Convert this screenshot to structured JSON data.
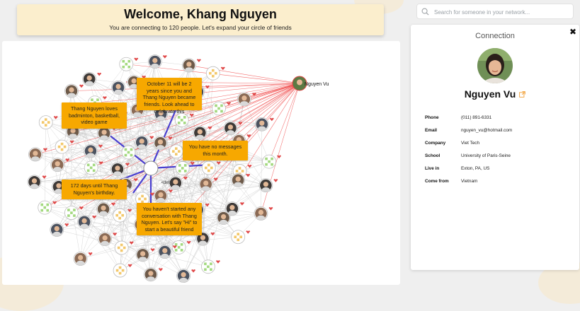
{
  "welcome": {
    "title": "Welcome, Khang Nguyen",
    "subtitle": "You are connecting to 120 people. Let's expand your circle of friends"
  },
  "search": {
    "placeholder": "Search for someone in your network..."
  },
  "graph": {
    "highlight_label": "Nguyen Vu",
    "center_label": "<del>",
    "tooltips": [
      "October 11 will be 2 years since you and Thang Nguyen became friends. Look ahead to celebrate this",
      "Thang Nguyen loves badminton, basketball, video game",
      "You have no messages this month.",
      "172 days until Thang Nguyen's birthday.",
      "You haven't started any conversation with Thang Nguyen. Let's say \"Hi\" to start a beautiful friend"
    ],
    "colors": {
      "edge": "#c9c9c9",
      "highlight_edge": "#ef3b3b",
      "focus_edge": "#4a3fd0",
      "tooltip": "#f7a800"
    }
  },
  "connection": {
    "title": "Connection",
    "close_icon": "close-icon",
    "name": "Nguyen Vu",
    "link_icon": "external-link-icon",
    "details": [
      {
        "label": "Phone",
        "value": "(011) 891-6331"
      },
      {
        "label": "Email",
        "value": "nguyen_vu@hotmail.com"
      },
      {
        "label": "Company",
        "value": "Viet Tech"
      },
      {
        "label": "School",
        "value": "University of Paris-Seine"
      },
      {
        "label": "Live in",
        "value": "Exton, PA, US"
      },
      {
        "label": "Come from",
        "value": "Vietnam"
      }
    ]
  }
}
